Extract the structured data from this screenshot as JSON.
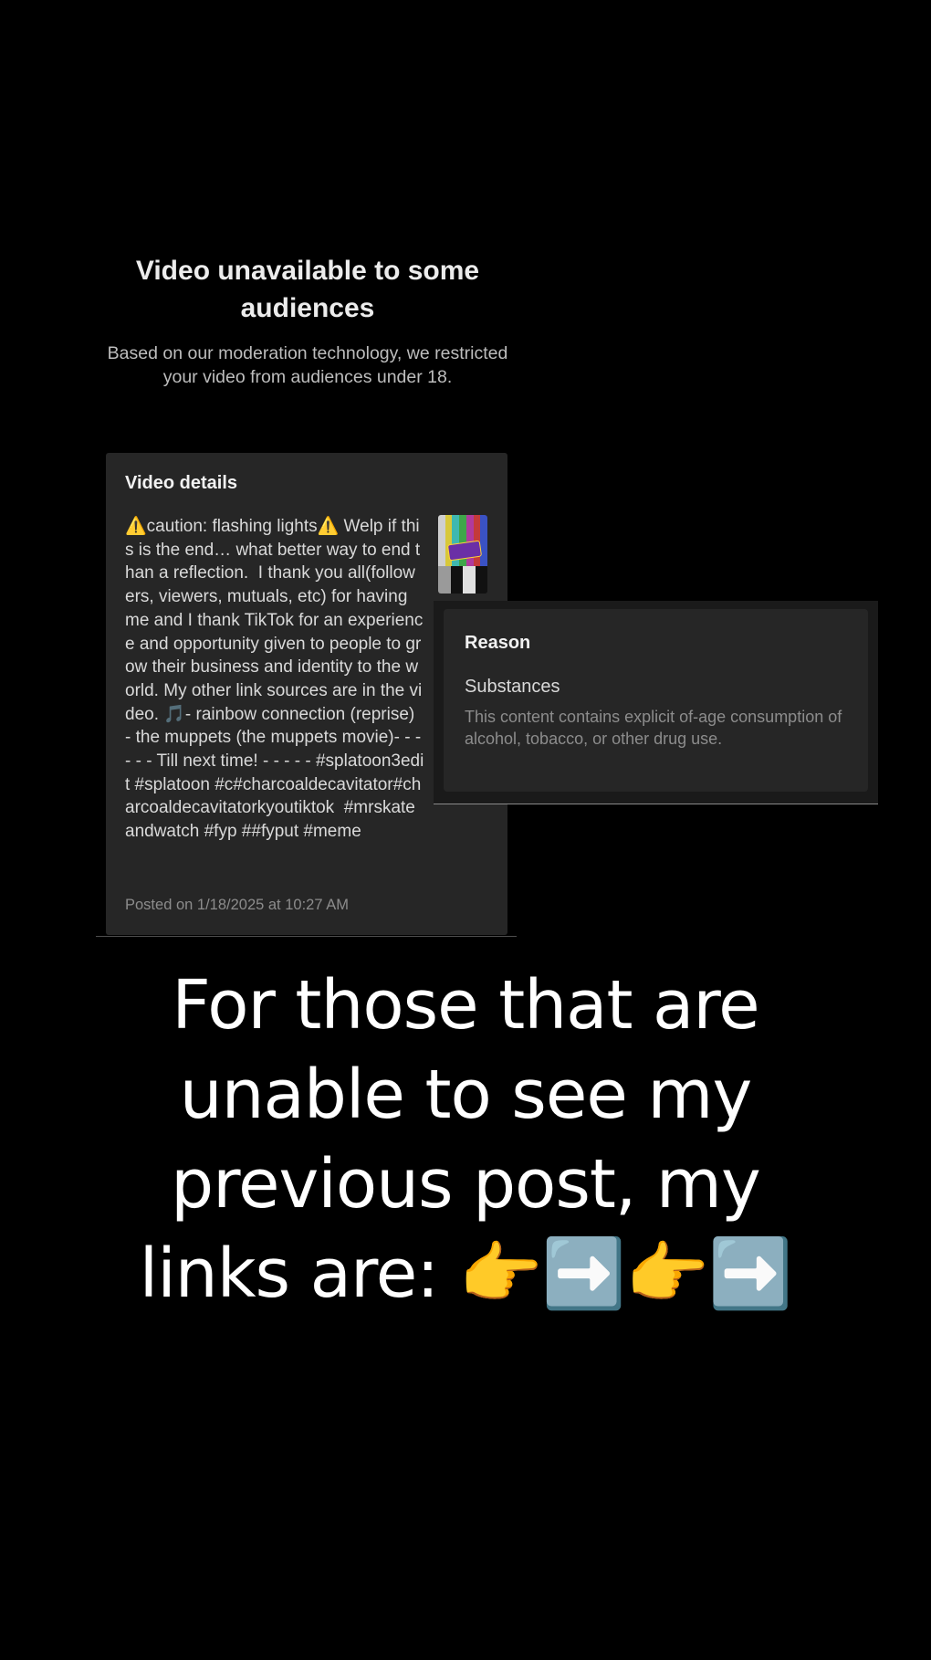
{
  "restriction": {
    "title": "Video unavailable to some audiences",
    "description": "Based on our moderation technology, we restricted your video from audiences under 18."
  },
  "video_details": {
    "heading": "Video details",
    "description": "⚠️caution: flashing lights⚠️ Welp if this is the end… what better way to end than a reflection.  I thank you all(followers, viewers, mutuals, etc) for having me and I thank TikTok for an experience and opportunity given to people to grow their business and identity to the world. My other link sources are in the video. 🎵- rainbow connection (reprise) - the muppets (the muppets movie)- - - - - - Till next time! - - - - - #splatoon3edit #splatoon #c#charcoaldecavitator#charcoaldecavitatorkyoutiktok  #mrskateandwatch #fyp ##fyput #meme",
    "posted": "Posted on 1/18/2025 at 10:27 AM"
  },
  "reason": {
    "heading": "Reason",
    "category": "Substances",
    "text": "This content contains explicit of-age consumption of alcohol, tobacco, or other drug use."
  },
  "caption": "For those that are unable to see my previous post, my links are: 👉➡️👉➡️",
  "colors": {
    "background": "#000000",
    "card": "#262626",
    "muted_text": "#8c8c8c"
  }
}
